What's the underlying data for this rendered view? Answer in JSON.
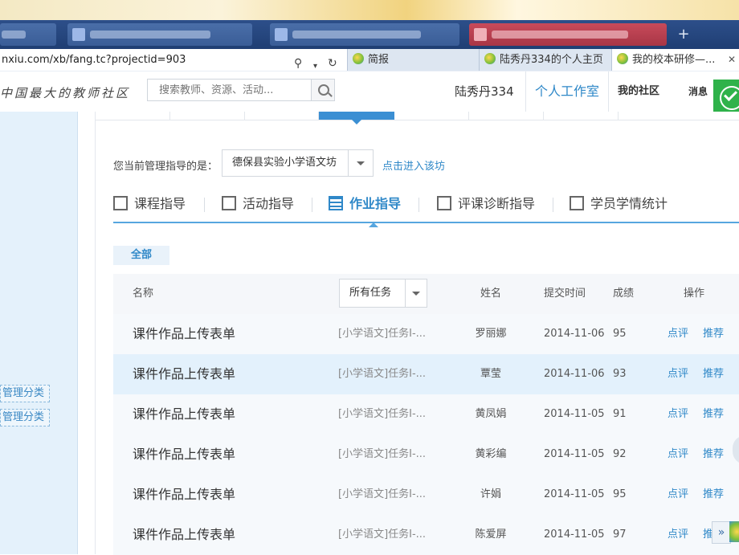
{
  "browser": {
    "address": "nxiu.com/xb/fang.tc?projectid=903",
    "tabs": [
      {
        "label": "简报",
        "active": false
      },
      {
        "label": "陆秀丹334的个人主页",
        "active": false
      },
      {
        "label": "我的校本研修—...",
        "active": true
      }
    ],
    "close_glyph": "✕"
  },
  "site": {
    "slogan": "中国最大的教师社区",
    "search_placeholder": "搜索教师、资源、活动...",
    "user_name": "陆秀丹334",
    "studio_link": "个人工作室",
    "community_link": "我的社区",
    "message_link": "消息"
  },
  "sidebar": {
    "categories": [
      "管理分类",
      "管理分类"
    ]
  },
  "main": {
    "current_label": "您当前管理指导的是：",
    "workshop": "德保县实验小学语文坊",
    "enter_link": "点击进入该坊",
    "tabs": [
      {
        "label": "课程指导",
        "icon": "course-icon",
        "active": false
      },
      {
        "label": "活动指导",
        "icon": "activity-icon",
        "active": false
      },
      {
        "label": "作业指导",
        "icon": "homework-icon",
        "active": true
      },
      {
        "label": "评课诊断指导",
        "icon": "comment-icon",
        "active": false
      },
      {
        "label": "学员学情统计",
        "icon": "stats-icon",
        "active": false
      }
    ],
    "filter_all": "全部",
    "table": {
      "headers": {
        "name": "名称",
        "task_filter": "所有任务",
        "student": "姓名",
        "time": "提交时间",
        "score": "成绩",
        "action": "操作"
      },
      "rows": [
        {
          "name": "课件作品上传表单",
          "task": "[小学语文]任务I-...",
          "student": "罗丽娜",
          "time": "2014-11-06",
          "score": "95",
          "act1": "点评",
          "act2": "推荐"
        },
        {
          "name": "课件作品上传表单",
          "task": "[小学语文]任务I-...",
          "student": "覃莹",
          "time": "2014-11-06",
          "score": "93",
          "act1": "点评",
          "act2": "推荐"
        },
        {
          "name": "课件作品上传表单",
          "task": "[小学语文]任务I-...",
          "student": "黄凤娟",
          "time": "2014-11-05",
          "score": "91",
          "act1": "点评",
          "act2": "推荐"
        },
        {
          "name": "课件作品上传表单",
          "task": "[小学语文]任务I-...",
          "student": "黄彩编",
          "time": "2014-11-05",
          "score": "92",
          "act1": "点评",
          "act2": "推荐"
        },
        {
          "name": "课件作品上传表单",
          "task": "[小学语文]任务I-...",
          "student": "许娟",
          "time": "2014-11-05",
          "score": "95",
          "act1": "点评",
          "act2": "推荐"
        },
        {
          "name": "课件作品上传表单",
          "task": "[小学语文]任务I-...",
          "student": "陈爱屏",
          "time": "2014-11-05",
          "score": "97",
          "act1": "点评",
          "act2": "推"
        }
      ]
    }
  },
  "floating": {
    "expand_glyph": "»"
  },
  "colors": {
    "accent": "#2f88c8",
    "badge_green": "#2fb24a",
    "sidebar_bg": "#e4f1fb"
  }
}
